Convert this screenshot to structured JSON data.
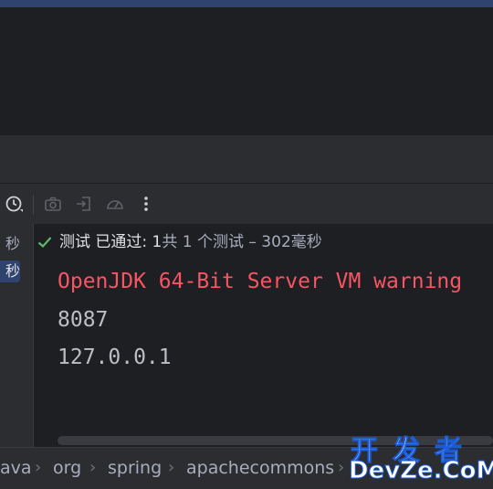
{
  "toolbar": {
    "icons": [
      "history-clock-icon",
      "camera-icon",
      "export-icon",
      "gauge-icon",
      "more-vertical-icon"
    ]
  },
  "left_panel": {
    "items": [
      "秒",
      "秒"
    ]
  },
  "test_status": {
    "passed_text": "测试 已通过: ",
    "passed_count": "1",
    "detail": "共 1 个测试 – 302毫秒"
  },
  "console_lines": [
    {
      "text": "OpenJDK 64-Bit Server VM warning",
      "color": "#f75464"
    },
    {
      "text": "8087",
      "color": "#bcbec4"
    },
    {
      "text": "127.0.0.1",
      "color": "#bcbec4"
    }
  ],
  "breadcrumb": [
    "ava",
    "org",
    "spring",
    "apachecommons"
  ],
  "watermark": {
    "top": "开发者",
    "bottom": "DevZe.CoM"
  }
}
